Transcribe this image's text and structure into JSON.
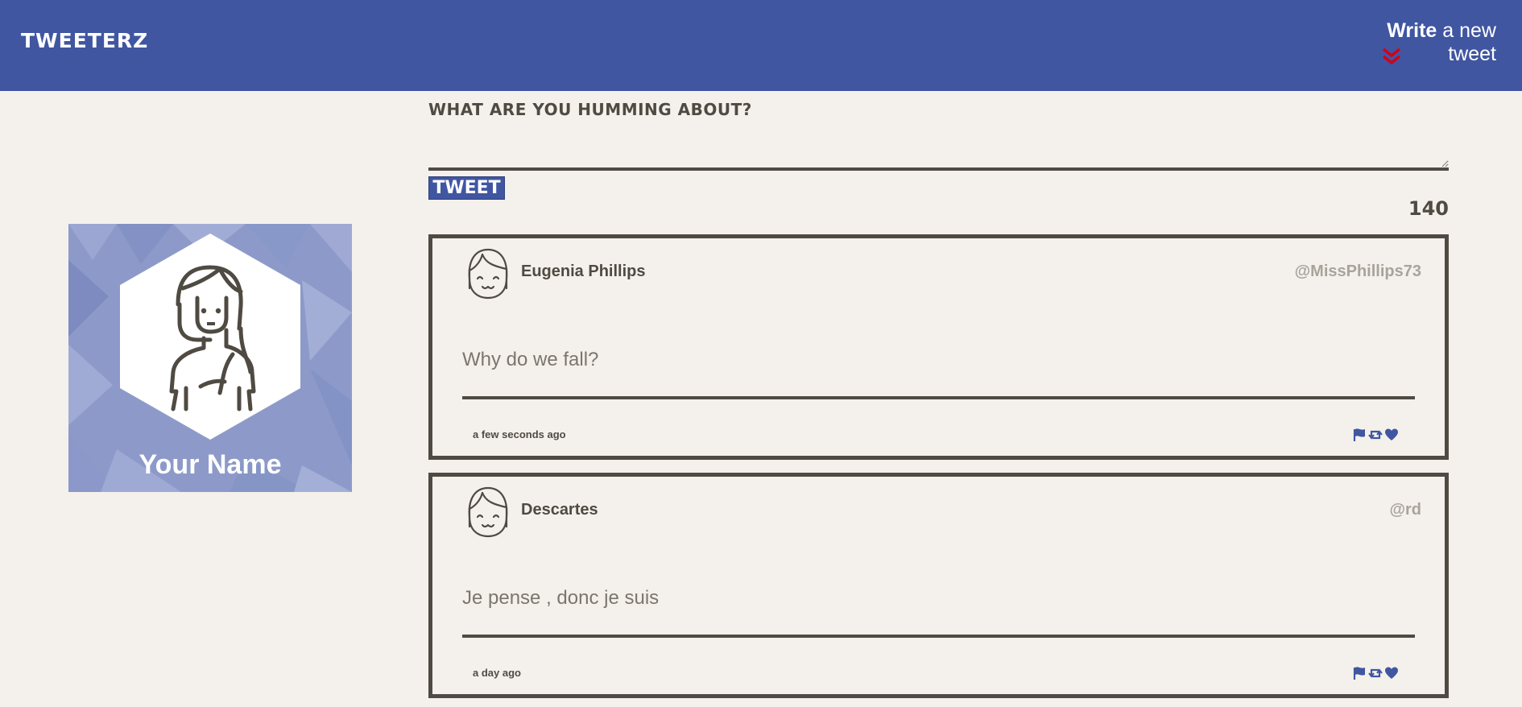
{
  "nav": {
    "brand": "Tweeterz",
    "compose_toggle": {
      "strong": "Write",
      "rest": " a new tweet",
      "icon": "double-chevron-down-icon",
      "icon_color": "#d0021b"
    }
  },
  "colors": {
    "nav_bg": "#4056a1",
    "page_bg": "#f4f1ec",
    "text": "#4f4a42",
    "handle": "#a8a39b"
  },
  "profile": {
    "name": "Your Name",
    "avatar": "user-avatar-icon"
  },
  "compose": {
    "label": "What are you humming about?",
    "textarea_value": "",
    "button_label": "Tweet",
    "counter": "140"
  },
  "tweets": [
    {
      "name": "Eugenia Phillips",
      "handle": "@MissPhillips73",
      "body": "Why do we fall?",
      "time": "a few seconds ago",
      "actions": [
        "flag-icon",
        "retweet-icon",
        "heart-icon"
      ]
    },
    {
      "name": "Descartes",
      "handle": "@rd",
      "body": "Je pense , donc je suis",
      "time": "a day ago",
      "actions": [
        "flag-icon",
        "retweet-icon",
        "heart-icon"
      ]
    }
  ]
}
